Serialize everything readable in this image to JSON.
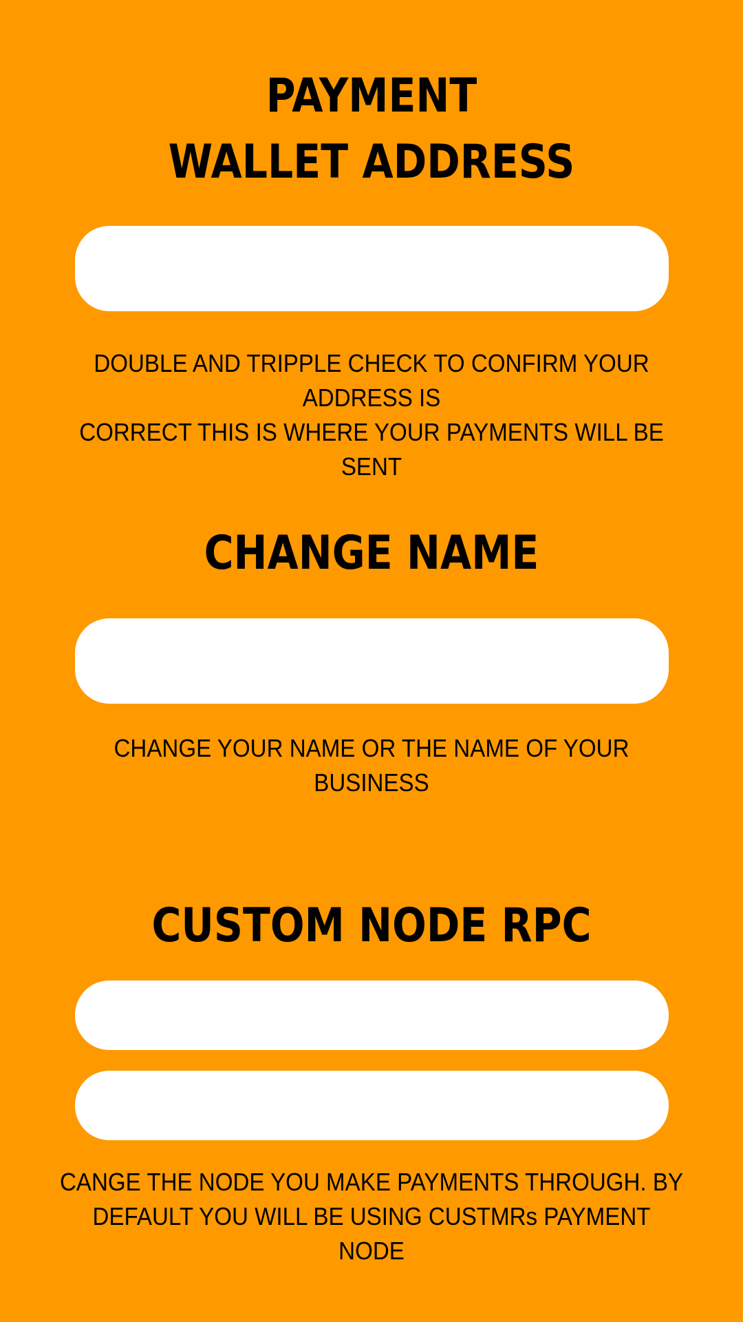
{
  "colors": {
    "background": "#FF9900",
    "field": "#FFFFFF",
    "text": "#000000"
  },
  "wallet": {
    "heading_line1": "PAYMENT",
    "heading_line2": "WALLET ADDRESS",
    "input_value": "",
    "helper_line1": "DOUBLE AND TRIPPLE CHECK TO CONFIRM YOUR ADDRESS IS",
    "helper_line2": "CORRECT THIS IS WHERE YOUR PAYMENTS WILL BE SENT"
  },
  "name": {
    "heading": "CHANGE NAME",
    "input_value": "",
    "helper": "CHANGE YOUR NAME OR THE NAME OF YOUR BUSINESS"
  },
  "node": {
    "heading": "CUSTOM NODE RPC",
    "input1_value": "",
    "input2_value": "",
    "helper_line1": "CANGE THE NODE YOU MAKE PAYMENTS THROUGH. BY",
    "helper_line2": "DEFAULT YOU WILL BE USING CUSTMRs PAYMENT",
    "helper_line3": "NODE"
  }
}
